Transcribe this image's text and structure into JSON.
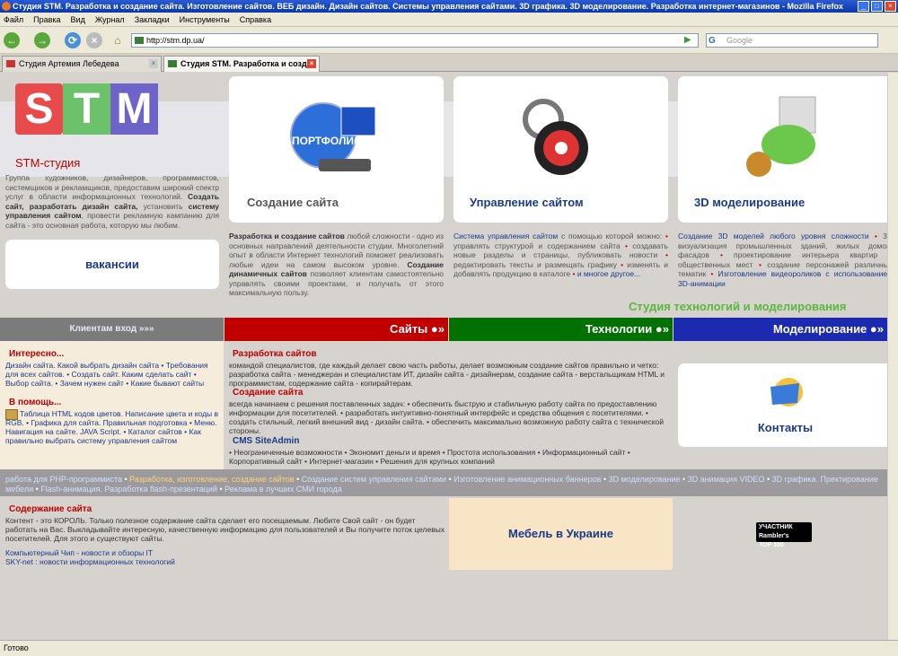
{
  "window": {
    "title": "Студия STM. Разработка и создание сайта. Изготовление сайтов. ВЕБ дизайн. Дизайн сайтов. Системы управления сайтами. 3D графика. 3D моделирование. Разработка интернет-магазинов - Mozilla Firefox"
  },
  "menu": [
    "Файл",
    "Правка",
    "Вид",
    "Журнал",
    "Закладки",
    "Инструменты",
    "Справка"
  ],
  "nav": {
    "url": "http://stm.dp.ua/",
    "search_placeholder": "Google"
  },
  "tabs": [
    {
      "label": "Студия Артемия Лебедева",
      "active": false
    },
    {
      "label": "Студия STM. Разработка и созд...",
      "active": true
    }
  ],
  "logo": {
    "letters": [
      "S",
      "T",
      "M"
    ],
    "colors": [
      "#e84b4b",
      "#6bc26b",
      "#6e63c9"
    ]
  },
  "studio": {
    "title": "STM-студия",
    "text_a": "Группа художников, дизайнеров, программистов, системщиков и рекламщиков, предоставим широкий спектр услуг в области информационных технологий.",
    "text_b": "Создать сайт, разработать дизайн сайта,",
    "text_c": "установить",
    "text_d": "систему управления сайтом",
    "text_e": ", провести рекламную кампанию для сайта - это основная работа, которую мы любим."
  },
  "vacancies": "вакансии",
  "cards": [
    {
      "title": "Создание сайта",
      "icon_label": "ПОРТФОЛИО"
    },
    {
      "title": "Управление сайтом"
    },
    {
      "title": "3D моделирование"
    }
  ],
  "desc1": {
    "b1": "Разработка и создание сайтов",
    "t1": "любой сложности - одно из основных направлений деятельности студии. Многолетний опыт в области Интернет технологий поможет реализовать любые идеи на самом высоком уровне.",
    "b2": "Создание динамичных сайтов",
    "t2": "позволяет клиентам самостоятельно управлять своими проектами, и получать от этого максимальную пользу."
  },
  "desc2": {
    "l1": "Система управления сайтом",
    "t1": "с помощью которой можно:",
    "items": [
      "управлять структурой и содержанием сайта",
      "создавать новые разделы и страницы, публиковать новости",
      "редактировать тексты и размещать графику",
      "изменять и добавлять продукцию в каталоге"
    ],
    "more": "и многое другое..."
  },
  "desc3": {
    "l1": "Создание 3D моделей любого уровня сложности",
    "items": [
      "3D визуализация промышленных зданий, жилых домов, фасадов",
      "проектирование интерьера квартир и общественных мест",
      "создание персонажей различных тематик",
      "Изготовление видеороликов с использованием 3D-анимации"
    ]
  },
  "slogan": "Студия технологий и моделирования",
  "bars": [
    "Клиентам вход »»»",
    "Сайты",
    "Технологии",
    "Моделирование"
  ],
  "interesting": {
    "heading": "Интересно...",
    "text": "Дизайн сайта. Какой выбрать дизайн сайта • Требования для всех сайтов. • Создать сайт. Каким сделать сайт • Выбор сайта. • Зачем нужен сайт • Какие бывают сайты"
  },
  "help": {
    "heading": "В помощь...",
    "text": "Таблица HTML кодов цветов. Написание цвета и коды в RGB. • Графика для сайта. Правильная подготовка • Меню. Навигация на сайте. JAVA Script. • Каталог сайтов • Как правильно выбрать систему управления сайтом"
  },
  "sections": [
    {
      "heading": "Разработка сайтов",
      "text": "командой специалистов, где каждый делает свою часть работы, делает возможным создание сайтов правильно и четко: разработка сайта - менеджеран и специалистам ИТ, дизайн сайта - дизайнерам, создание сайта - верстальщикам HTML и программистам, содержание сайта - копирайтерам."
    },
    {
      "heading": "Создание сайта",
      "text": "всегда начинаем с решения поставленных задач: • обеспечить быструю и стабильную работу сайта по предоставлению информации для посетителей. • разработать интуитивно-понятный интерфейс и средства общения с посетителями. • создать стильный, легкий внешний вид - дизайн сайта. • обеспечить максимально возможную работу сайта с технической стороны."
    },
    {
      "heading": "CMS SiteAdmin",
      "text": "• Неограниченные возможности • Экономит деньги и время • Простота использования • Информационный сайт • Корпоративный сайт • Интернет-магазин • Решения для крупных компаний"
    }
  ],
  "contacts": "Контакты",
  "linkband": [
    [
      "работа для PHP-программиста",
      "b"
    ],
    [
      "Разработка, изготовление, создание сайтов",
      "y"
    ],
    [
      "Создание систем управления сайтами",
      "b"
    ],
    [
      "Изготовление анимационных баннеров",
      "b"
    ],
    [
      "3D моделирование",
      "b"
    ],
    [
      "3D анимация VIDEO",
      "b"
    ],
    [
      "3D графика. Пректирование мебели",
      "b"
    ],
    [
      "Flash-анимация. Разработка flash-презентаций",
      "b"
    ],
    [
      "Реклама в лучших СМИ города",
      "b"
    ]
  ],
  "content_section": {
    "heading": "Содержание сайта",
    "text": "Контент - это КОРОЛЬ. Только полезное содержание сайта сделает его посещаемым. Любите Свой сайт - он будет работать на Вас. Выкладывайте интересную, качественную информацию для пользователей и Вы получите поток целевых посетителей. Для этого и существуют сайты.",
    "link1": "Компьютерный Чип - новости и обзоры IT",
    "link2": "SKY-net : новости информационных технологий"
  },
  "furniture": "Мебель в Украине",
  "top100": {
    "line1": "УЧАСТНИК",
    "line2": "Rambler's",
    "line3": "TOP 100"
  },
  "status": "Готово"
}
